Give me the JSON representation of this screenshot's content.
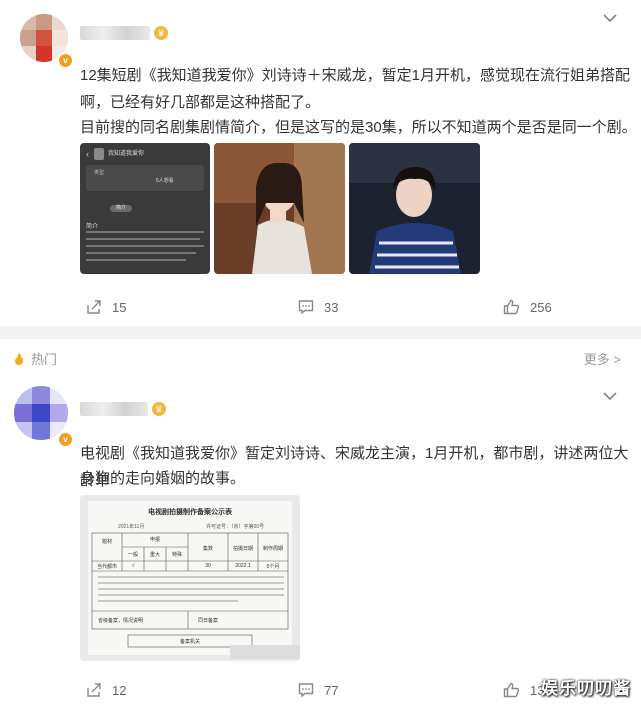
{
  "post1": {
    "text_line1": "12集短剧《我知道我爱你》刘诗诗＋宋威龙，暂定1月开机，感觉现在流行姐弟搭配",
    "text_line2": "啊，已经有好几部都是这种搭配了。",
    "text_line3": "目前搜的同名剧集剧情简介，但是这写的是30集，所以不知道两个是否是同一个剧。",
    "images": [
      {
        "kind": "app-screenshot",
        "app_name": "我知道我爱你",
        "rows": [
          "类型",
          "5人想看"
        ],
        "tag": "简介",
        "heading": "简介"
      },
      {
        "kind": "actress-photo"
      },
      {
        "kind": "actor-photo"
      }
    ],
    "share_count": "15",
    "comment_count": "33",
    "like_count": "256"
  },
  "hot_label": "热门",
  "more_label": "更多 >",
  "post2": {
    "text_line1": "电视剧《我知道我爱你》暂定刘诗诗、宋威龙主演，1月开机，都市剧，讲述两位大龄单",
    "text_line2": "身狗的走向婚姻的故事。",
    "document": {
      "title": "电视剧拍摄制作备案公示表",
      "date": "2021年11月",
      "license": "许可证号：（京）字第00号",
      "headers": [
        "题材",
        "申报",
        "集数",
        "拍摄日期",
        "制作周期"
      ],
      "sub_headers": [
        "一般",
        "重大",
        "特殊"
      ],
      "row": [
        "当代都市",
        "√",
        "",
        "",
        "30",
        "2022.1",
        "5个月"
      ],
      "footer_left": "省级备案，情况说明",
      "footer_right": "同日备案",
      "footer_bottom": "备案机关"
    },
    "share_count": "12",
    "comment_count": "77",
    "like_count": "13"
  },
  "watermark": "娱乐叨叨酱",
  "colors": {
    "accent": "#f0a020",
    "icon": "#888888",
    "bg": "#f2f2f2"
  }
}
